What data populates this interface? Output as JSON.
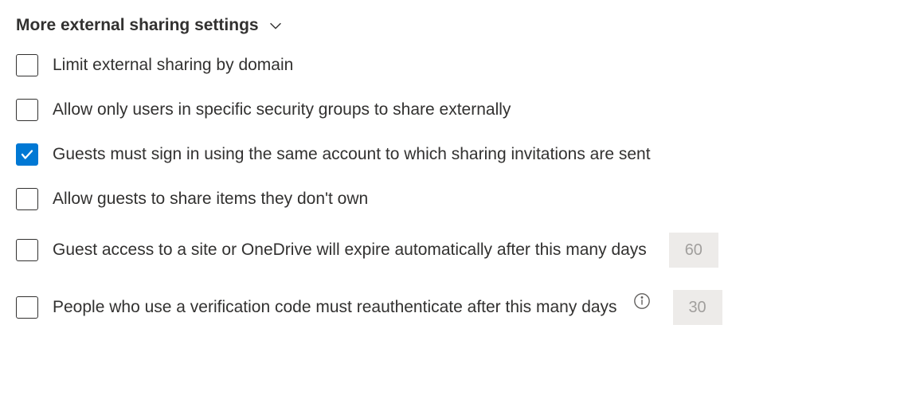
{
  "section": {
    "title": "More external sharing settings"
  },
  "settings": {
    "limit_domain": {
      "label": "Limit external sharing by domain",
      "checked": false
    },
    "security_groups": {
      "label": "Allow only users in specific security groups to share externally",
      "checked": false
    },
    "guests_same_account": {
      "label": "Guests must sign in using the same account to which sharing invitations are sent",
      "checked": true
    },
    "guests_share": {
      "label": "Allow guests to share items they don't own",
      "checked": false
    },
    "guest_expire": {
      "label": "Guest access to a site or OneDrive will expire automatically after this many days",
      "checked": false,
      "value": "60"
    },
    "verification_reauth": {
      "label": "People who use a verification code must reauthenticate after this many days",
      "checked": false,
      "value": "30"
    }
  }
}
